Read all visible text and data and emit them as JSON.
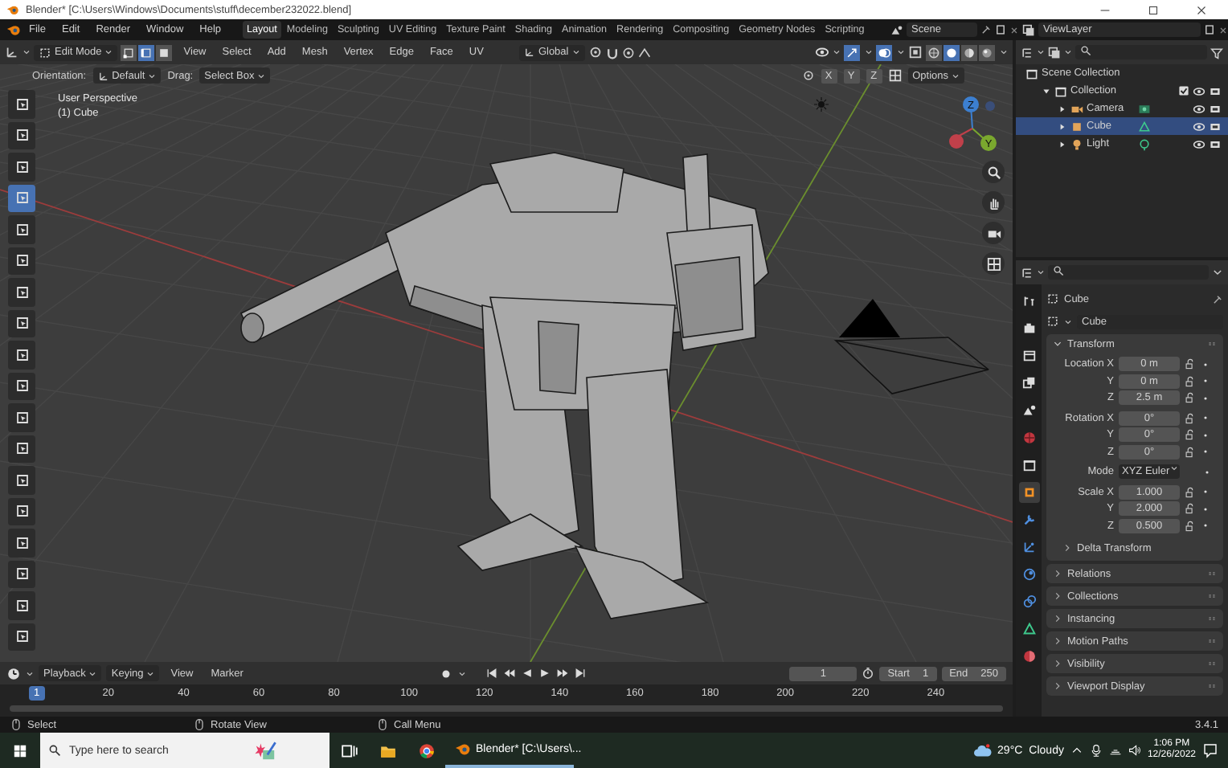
{
  "window": {
    "title": "Blender* [C:\\Users\\Windows\\Documents\\stuff\\december232022.blend]"
  },
  "menus": [
    "File",
    "Edit",
    "Render",
    "Window",
    "Help"
  ],
  "workspaces": [
    {
      "label": "Layout",
      "selected": true
    },
    {
      "label": "Modeling",
      "selected": false
    },
    {
      "label": "Sculpting",
      "selected": false
    },
    {
      "label": "UV Editing",
      "selected": false
    },
    {
      "label": "Texture Paint",
      "selected": false
    },
    {
      "label": "Shading",
      "selected": false
    },
    {
      "label": "Animation",
      "selected": false
    },
    {
      "label": "Rendering",
      "selected": false
    },
    {
      "label": "Compositing",
      "selected": false
    },
    {
      "label": "Geometry Nodes",
      "selected": false
    },
    {
      "label": "Scripting",
      "selected": false
    }
  ],
  "scene": "Scene",
  "view_layer": "ViewLayer",
  "viewport_header": {
    "mode": "Edit Mode",
    "select_modes": [
      {
        "kind": "vertex",
        "selected": false
      },
      {
        "kind": "edge",
        "selected": true
      },
      {
        "kind": "face",
        "selected": false
      }
    ],
    "menus": [
      "View",
      "Select",
      "Add",
      "Mesh",
      "Vertex",
      "Edge",
      "Face",
      "UV"
    ],
    "orientation": "Global",
    "shading": [
      {
        "kind": "wireframe",
        "selected": false
      },
      {
        "kind": "solid",
        "selected": true
      },
      {
        "kind": "material",
        "selected": false
      },
      {
        "kind": "rendered",
        "selected": false
      }
    ]
  },
  "tool_settings": {
    "orientation_label": "Orientation:",
    "orientation": "Default",
    "drag_label": "Drag:",
    "drag": "Select Box",
    "axes": [
      "X",
      "Y",
      "Z"
    ],
    "options": "Options"
  },
  "viewport": {
    "view_name": "User Perspective",
    "object_name": "(1) Cube",
    "gizmo_axes": [
      "Z",
      "Y"
    ]
  },
  "toolbar": [
    {
      "selected": false
    },
    {
      "selected": false
    },
    {
      "selected": false
    },
    {
      "selected": true
    },
    {
      "selected": false
    },
    {
      "selected": false
    },
    {
      "selected": false
    },
    {
      "selected": false
    },
    {
      "selected": false
    },
    {
      "selected": false
    },
    {
      "selected": false
    },
    {
      "selected": false
    },
    {
      "selected": false
    },
    {
      "selected": false
    },
    {
      "selected": false
    },
    {
      "selected": false
    },
    {
      "selected": false
    },
    {
      "selected": false
    }
  ],
  "outliner": [
    {
      "label": "Scene Collection",
      "kind": "scene",
      "children": [
        {
          "label": "Collection",
          "kind": "collection",
          "checked": true,
          "expanded": true,
          "children": [
            {
              "label": "Camera",
              "kind": "camera",
              "selected": false,
              "expanded": false
            },
            {
              "label": "Cube",
              "kind": "mesh",
              "selected": true,
              "expanded": false
            },
            {
              "label": "Light",
              "kind": "light",
              "selected": false,
              "expanded": false
            }
          ]
        }
      ]
    }
  ],
  "properties": {
    "tabs": [
      {
        "kind": "tool",
        "selected": false
      },
      {
        "kind": "render",
        "selected": false
      },
      {
        "kind": "output",
        "selected": false
      },
      {
        "kind": "view-layer",
        "selected": false
      },
      {
        "kind": "scene",
        "selected": false
      },
      {
        "kind": "world",
        "selected": false
      },
      {
        "kind": "collection",
        "selected": false
      },
      {
        "kind": "object",
        "selected": true
      },
      {
        "kind": "modifier",
        "selected": false
      },
      {
        "kind": "particles",
        "selected": false
      },
      {
        "kind": "physics",
        "selected": false
      },
      {
        "kind": "constraints",
        "selected": false
      },
      {
        "kind": "data",
        "selected": false
      },
      {
        "kind": "material",
        "selected": false
      }
    ],
    "object": "Cube",
    "name": "Cube",
    "transform": {
      "title": "Transform",
      "expanded": true,
      "groups": [
        [
          {
            "label": "Location X",
            "value": "0 m",
            "kind": "number"
          },
          {
            "label": "Y",
            "value": "0 m",
            "kind": "number"
          },
          {
            "label": "Z",
            "value": "2.5 m",
            "kind": "number"
          }
        ],
        [
          {
            "label": "Rotation X",
            "value": "0°",
            "kind": "number"
          },
          {
            "label": "Y",
            "value": "0°",
            "kind": "number"
          },
          {
            "label": "Z",
            "value": "0°",
            "kind": "number"
          }
        ],
        [
          {
            "label": "Mode",
            "value": "XYZ Euler",
            "kind": "dropdown"
          }
        ],
        [
          {
            "label": "Scale X",
            "value": "1.000",
            "kind": "number"
          },
          {
            "label": "Y",
            "value": "2.000",
            "kind": "number"
          },
          {
            "label": "Z",
            "value": "0.500",
            "kind": "number"
          }
        ]
      ],
      "subpanel": {
        "title": "Delta Transform",
        "expanded": false
      }
    },
    "panels": [
      {
        "title": "Relations",
        "expanded": false
      },
      {
        "title": "Collections",
        "expanded": false
      },
      {
        "title": "Instancing",
        "expanded": false
      },
      {
        "title": "Motion Paths",
        "expanded": false
      },
      {
        "title": "Visibility",
        "expanded": false
      },
      {
        "title": "Viewport Display",
        "expanded": false
      }
    ]
  },
  "timeline": {
    "menus": [
      {
        "label": "Playback",
        "kind": "dropdown"
      },
      {
        "label": "Keying",
        "kind": "dropdown"
      },
      {
        "label": "View",
        "kind": "menu"
      },
      {
        "label": "Marker",
        "kind": "menu"
      }
    ],
    "current_frame": "1",
    "start_label": "Start",
    "start": "1",
    "end_label": "End",
    "end": "250",
    "ruler_current": "1",
    "ruler_ticks": [
      "20",
      "40",
      "60",
      "80",
      "100",
      "120",
      "140",
      "160",
      "180",
      "200",
      "220",
      "240"
    ]
  },
  "status_bar": {
    "hints": [
      "Select",
      "Rotate View",
      "Call Menu"
    ],
    "version": "3.4.1"
  },
  "taskbar": {
    "search_placeholder": "Type here to search",
    "app": "Blender* [C:\\Users\\...",
    "temperature": "29°C",
    "weather": "Cloudy",
    "time": "1:06 PM",
    "date": "12/26/2022"
  }
}
